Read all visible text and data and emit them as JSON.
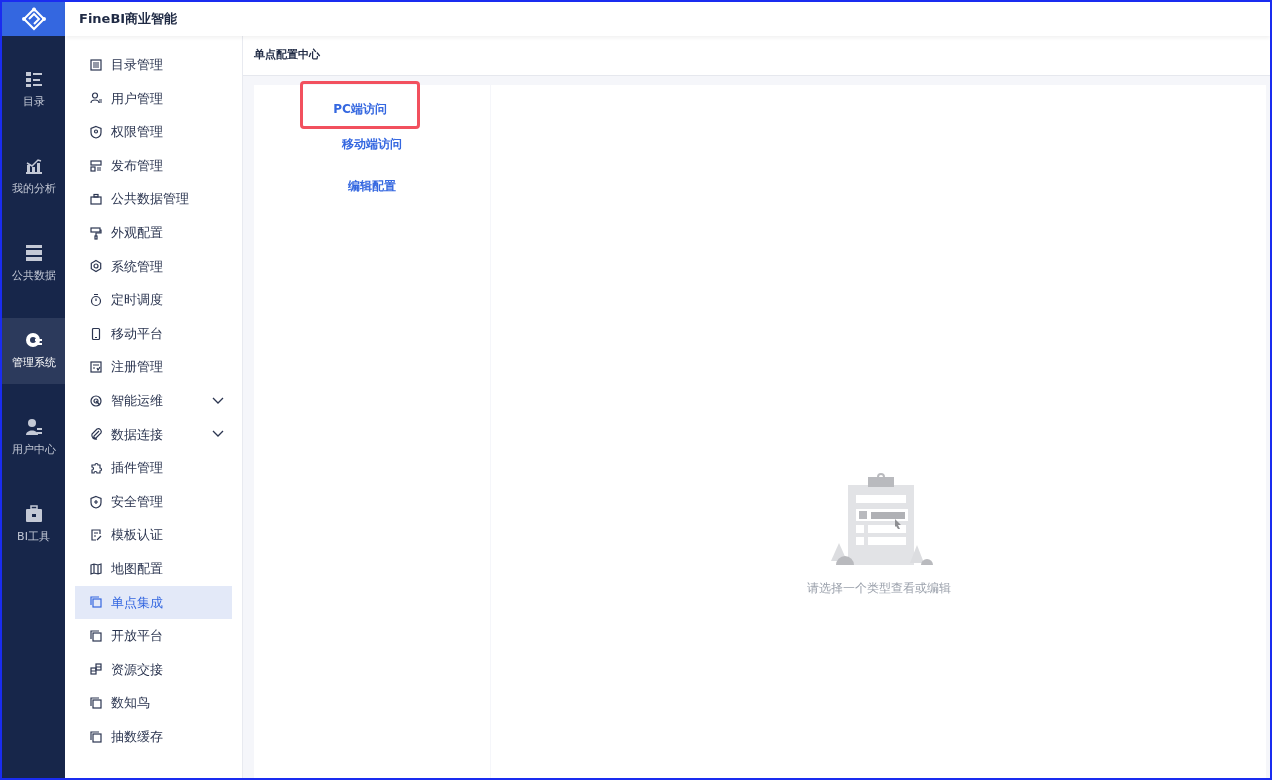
{
  "app": {
    "title": "FineBI商业智能"
  },
  "rail": [
    {
      "label": "目录",
      "selected": false
    },
    {
      "label": "我的分析",
      "selected": false
    },
    {
      "label": "公共数据",
      "selected": false
    },
    {
      "label": "管理系统",
      "selected": true
    },
    {
      "label": "用户中心",
      "selected": false
    },
    {
      "label": "BI工具",
      "selected": false
    }
  ],
  "menu": [
    {
      "label": "目录管理",
      "selected": false
    },
    {
      "label": "用户管理",
      "selected": false
    },
    {
      "label": "权限管理",
      "selected": false
    },
    {
      "label": "发布管理",
      "selected": false
    },
    {
      "label": "公共数据管理",
      "selected": false
    },
    {
      "label": "外观配置",
      "selected": false
    },
    {
      "label": "系统管理",
      "selected": false
    },
    {
      "label": "定时调度",
      "selected": false
    },
    {
      "label": "移动平台",
      "selected": false
    },
    {
      "label": "注册管理",
      "selected": false
    },
    {
      "label": "智能运维",
      "selected": false,
      "expanded": false
    },
    {
      "label": "数据连接",
      "selected": false,
      "expanded": false
    },
    {
      "label": "插件管理",
      "selected": false
    },
    {
      "label": "安全管理",
      "selected": false
    },
    {
      "label": "模板认证",
      "selected": false
    },
    {
      "label": "地图配置",
      "selected": false
    },
    {
      "label": "单点集成",
      "selected": true
    },
    {
      "label": "开放平台",
      "selected": false
    },
    {
      "label": "资源交接",
      "selected": false
    },
    {
      "label": "数知鸟",
      "selected": false
    },
    {
      "label": "抽数缓存",
      "selected": false
    }
  ],
  "page": {
    "title": "单点配置中心",
    "tabs": [
      {
        "label": "PC端访问",
        "highlighted": true
      },
      {
        "label": "移动端访问",
        "highlighted": false
      },
      {
        "label": "编辑配置",
        "highlighted": false
      }
    ],
    "empty_message": "请选择一个类型查看或编辑"
  }
}
